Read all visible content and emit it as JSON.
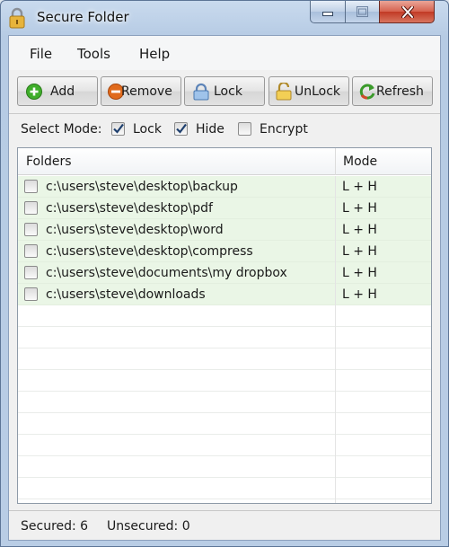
{
  "window": {
    "title": "Secure Folder"
  },
  "menu": [
    "File",
    "Tools",
    "Help"
  ],
  "toolbar": {
    "add": "Add",
    "remove": "Remove",
    "lock": "Lock",
    "unlock": "UnLock",
    "refresh": "Refresh"
  },
  "select_mode": {
    "label": "Select Mode:",
    "options": [
      {
        "label": "Lock",
        "checked": true
      },
      {
        "label": "Hide",
        "checked": true
      },
      {
        "label": "Encrypt",
        "checked": false
      }
    ]
  },
  "list": {
    "columns": {
      "folders": "Folders",
      "mode": "Mode"
    },
    "rows": [
      {
        "path": "c:\\users\\steve\\desktop\\backup",
        "mode": "L + H",
        "checked": false
      },
      {
        "path": "c:\\users\\steve\\desktop\\pdf",
        "mode": "L + H",
        "checked": false
      },
      {
        "path": "c:\\users\\steve\\desktop\\word",
        "mode": "L + H",
        "checked": false
      },
      {
        "path": "c:\\users\\steve\\desktop\\compress",
        "mode": "L + H",
        "checked": false
      },
      {
        "path": "c:\\users\\steve\\documents\\my dropbox",
        "mode": "L + H",
        "checked": false
      },
      {
        "path": "c:\\users\\steve\\downloads",
        "mode": "L + H",
        "checked": false
      }
    ]
  },
  "status": {
    "secured": "Secured: 6",
    "unsecured": "Unsecured: 0"
  },
  "icons": {
    "app": "padlock-icon",
    "add": "plus-circle-icon",
    "remove": "minus-circle-icon",
    "lock": "lock-icon",
    "unlock": "unlock-icon",
    "refresh": "refresh-icon"
  },
  "colors": {
    "row_fill": "#eaf6e6",
    "add_green": "#3fae2a",
    "remove_orange": "#e06a1c",
    "close_red": "#c13a25"
  }
}
